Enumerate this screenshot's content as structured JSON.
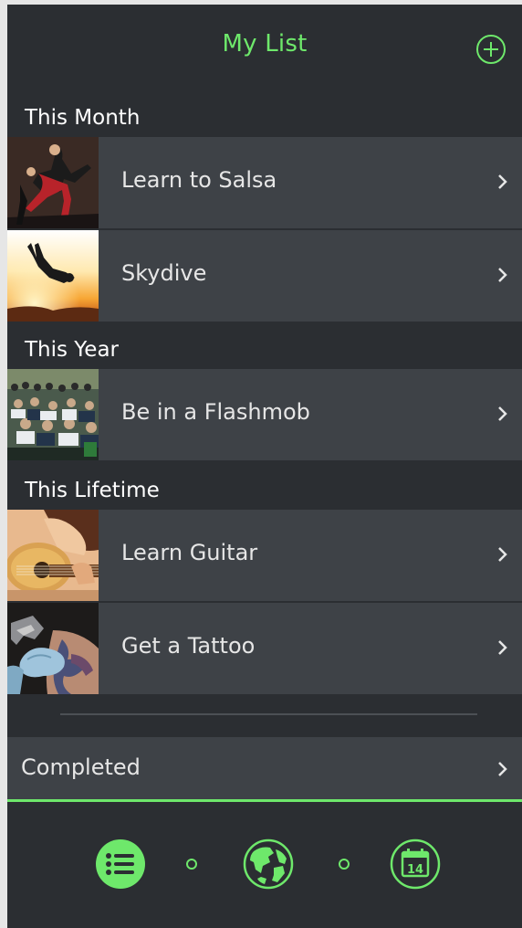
{
  "header": {
    "title": "My List",
    "add_icon": "plus-circle-icon"
  },
  "sections": [
    {
      "title": "This Month",
      "items": [
        {
          "label": "Learn to Salsa",
          "image": "salsa-dancers-photo"
        },
        {
          "label": "Skydive",
          "image": "skydiver-sunset-photo"
        }
      ]
    },
    {
      "title": "This Year",
      "items": [
        {
          "label": "Be in a Flashmob",
          "image": "crowd-photo"
        }
      ]
    },
    {
      "title": "This Lifetime",
      "items": [
        {
          "label": "Learn Guitar",
          "image": "guitar-player-photo"
        },
        {
          "label": "Get a Tattoo",
          "image": "tattoo-artist-photo"
        }
      ]
    }
  ],
  "completed": {
    "label": "Completed"
  },
  "tabbar": {
    "tabs": [
      {
        "icon": "list-icon",
        "active": true
      },
      {
        "icon": "globe-icon",
        "active": false
      },
      {
        "icon": "calendar-icon",
        "active": false,
        "calendar_day": "14"
      }
    ]
  },
  "colors": {
    "accent": "#6ee86b",
    "background": "#2b2e32",
    "row": "#3e4247",
    "text": "#e6e6e6"
  }
}
